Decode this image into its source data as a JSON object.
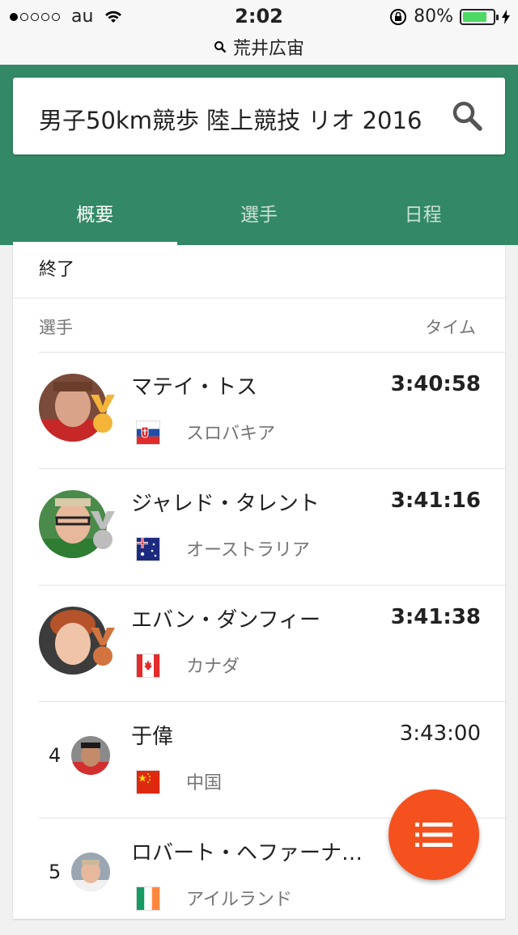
{
  "status_bar": {
    "carrier": "au",
    "time": "2:02",
    "battery": "80%",
    "battery_level": 0.8,
    "url": "荒井広宙"
  },
  "search": {
    "query": "男子50km競歩 陸上競技 リオ 2016"
  },
  "tabs": [
    {
      "label": "概要",
      "active": true
    },
    {
      "label": "選手",
      "active": false
    },
    {
      "label": "日程",
      "active": false
    }
  ],
  "event_status": "終了",
  "table": {
    "col_athlete": "選手",
    "col_time": "タイム",
    "rows": [
      {
        "rank": "",
        "name": "マテイ・トス",
        "country": "スロバキア",
        "time": "3:40:58",
        "medal": "gold",
        "medal_color": "#f4b43a",
        "flag": "slovakia-flag"
      },
      {
        "rank": "",
        "name": "ジャレド・タレント",
        "country": "オーストラリア",
        "time": "3:41:16",
        "medal": "silver",
        "medal_color": "#bdbdbd",
        "flag": "australia-flag"
      },
      {
        "rank": "",
        "name": "エバン・ダンフィー",
        "country": "カナダ",
        "time": "3:41:38",
        "medal": "bronze",
        "medal_color": "#d2743f",
        "flag": "canada-flag"
      },
      {
        "rank": "4",
        "name": "于偉",
        "country": "中国",
        "time": "3:43:00",
        "medal": "",
        "flag": "china-flag"
      },
      {
        "rank": "5",
        "name": "ロバート・ヘファーナ…",
        "country": "アイルランド",
        "time": "",
        "medal": "",
        "flag": "ireland-flag"
      }
    ]
  },
  "colors": {
    "header_green": "#338965",
    "fab_orange": "#f4511e"
  }
}
